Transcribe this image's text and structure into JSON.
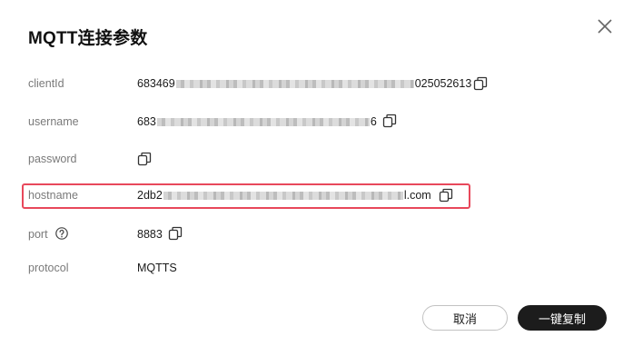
{
  "dialog": {
    "title": "MQTT连接参数",
    "close_icon": "close-icon"
  },
  "fields": {
    "clientid": {
      "label": "clientId",
      "value_prefix": "683469",
      "value_suffix": "025052613"
    },
    "username": {
      "label": "username",
      "value_prefix": "683",
      "value_suffix": "6"
    },
    "password": {
      "label": "password",
      "value": ""
    },
    "hostname": {
      "label": "hostname",
      "value_prefix": "2db2",
      "value_suffix": "l.com"
    },
    "port": {
      "label": "port",
      "value": "8883"
    },
    "protocol": {
      "label": "protocol",
      "value": "MQTTS"
    }
  },
  "buttons": {
    "cancel": "取消",
    "copy_all": "一键复制"
  },
  "colors": {
    "highlight": "#e8485b",
    "primary_button": "#1c1c1c",
    "label": "#7a7a7a"
  },
  "icons": {
    "copy": "copy-icon",
    "help": "question-circle-icon"
  }
}
